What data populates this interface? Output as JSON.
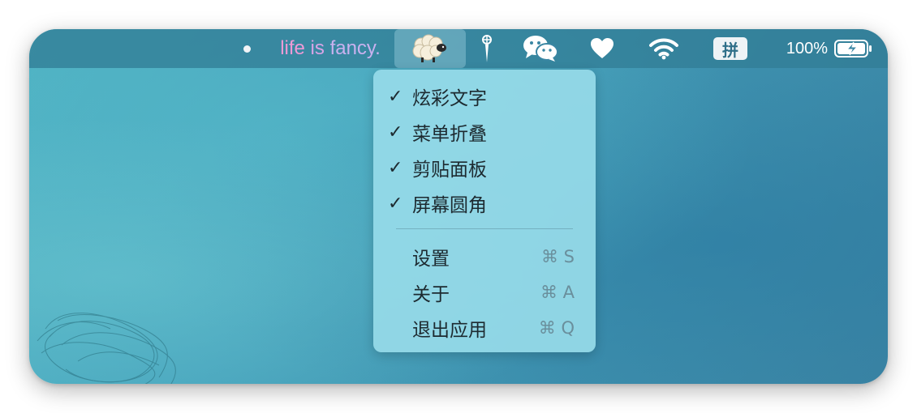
{
  "menubar": {
    "fancy_text": [
      "life",
      "is",
      "fancy."
    ],
    "battery_percent": "100%",
    "ime_label": "拼",
    "icons": [
      "dot-indicator-icon",
      "sheep-icon",
      "pin-icon",
      "wechat-icon",
      "heart-icon",
      "wifi-icon",
      "ime-icon",
      "battery-charging-icon"
    ]
  },
  "menu": {
    "toggles": [
      {
        "check": "✓",
        "label": "炫彩文字"
      },
      {
        "check": "✓",
        "label": "菜单折叠"
      },
      {
        "check": "✓",
        "label": "剪贴面板"
      },
      {
        "check": "✓",
        "label": "屏幕圆角"
      }
    ],
    "actions": [
      {
        "label": "设置",
        "shortcut": "⌘ S"
      },
      {
        "label": "关于",
        "shortcut": "⌘ A"
      },
      {
        "label": "退出应用",
        "shortcut": "⌘ Q"
      }
    ]
  },
  "colors": {
    "fancy_gradient": [
      "#ee9ad6",
      "#d8a4e6",
      "#c9b1ef"
    ],
    "menu_background": "#96dae8",
    "wallpaper": "#47a4bd"
  }
}
